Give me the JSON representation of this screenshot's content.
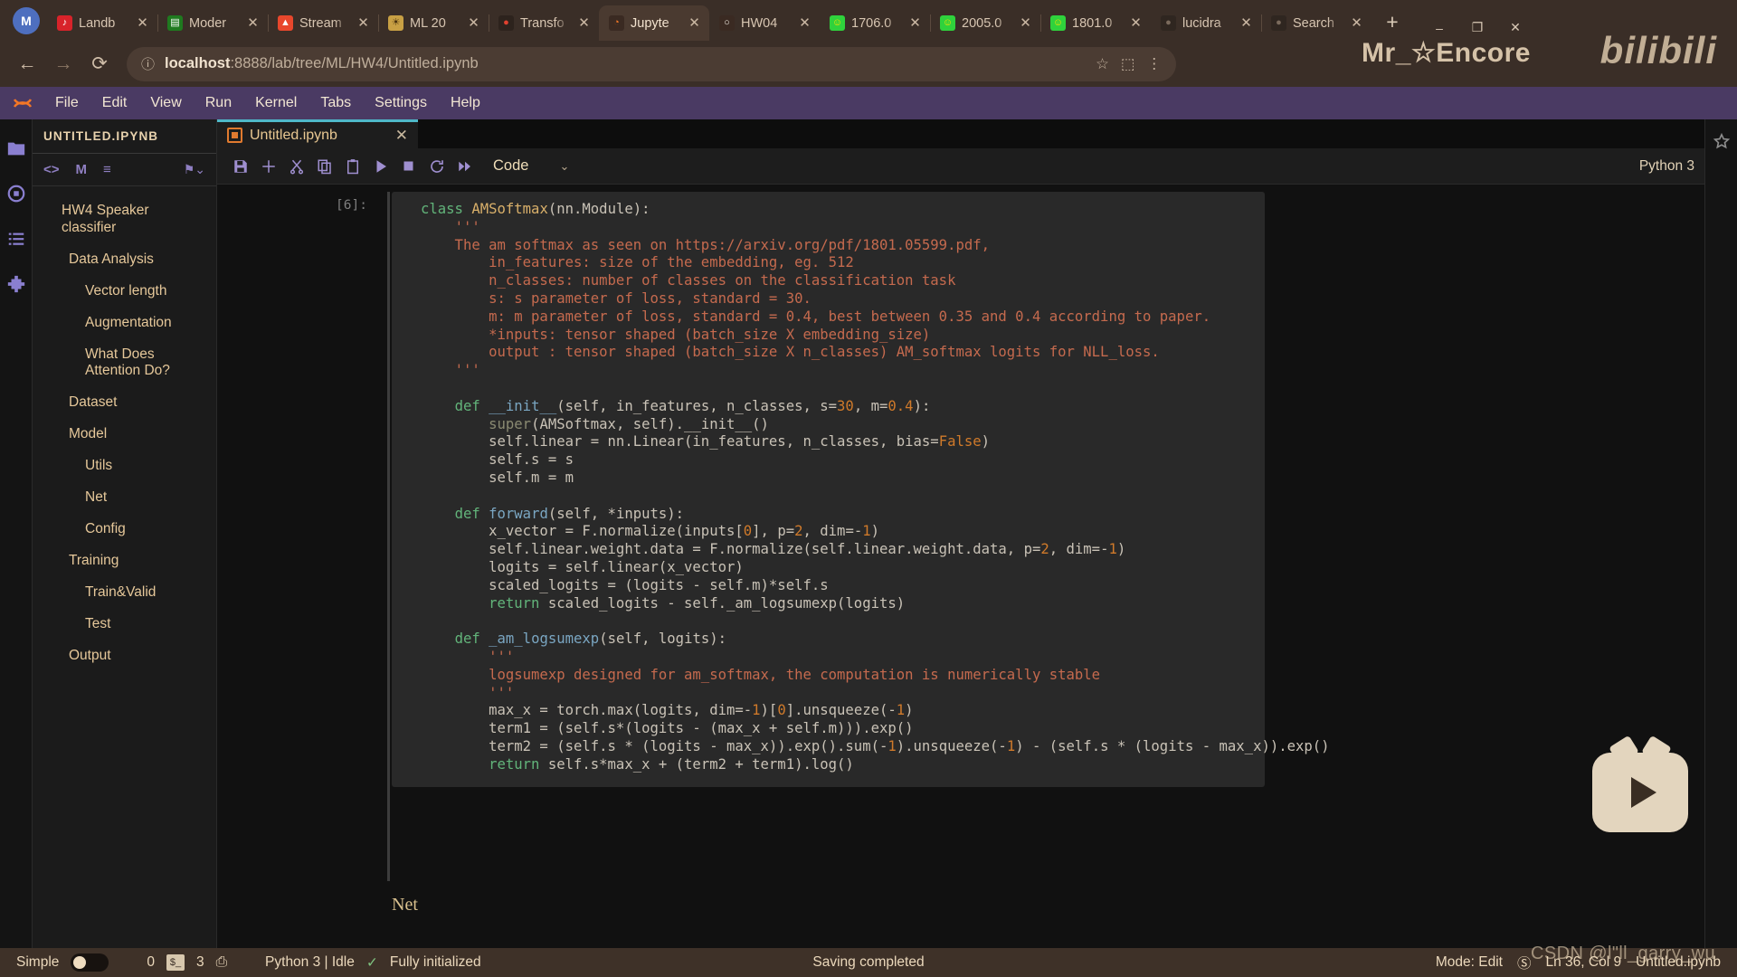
{
  "browser": {
    "profile_initial": "M",
    "tabs": [
      {
        "title": "Landb",
        "icon": "netease-music-icon",
        "glyph": "♪",
        "bg": "#d8232a",
        "fg": "#ffffff",
        "active": false
      },
      {
        "title": "Moder",
        "icon": "model-icon",
        "glyph": "▤",
        "bg": "#1f7a1f",
        "fg": "#ffffff",
        "active": false
      },
      {
        "title": "Stream",
        "icon": "streamlit-icon",
        "glyph": "▲",
        "bg": "#e8472c",
        "fg": "#ffffff",
        "active": false
      },
      {
        "title": "ML 20",
        "icon": "lion-icon",
        "glyph": "☀",
        "bg": "#c8a044",
        "fg": "#4a3310",
        "active": false
      },
      {
        "title": "Transfo",
        "icon": "huggingface-icon",
        "glyph": "●",
        "bg": "#2d231d",
        "fg": "#e0412f",
        "active": false
      },
      {
        "title": "Jupyte",
        "icon": "jupyter-icon",
        "glyph": "◔",
        "bg": "#3a2a22",
        "fg": "#f37726",
        "active": true
      },
      {
        "title": "HW04",
        "icon": "colab-icon",
        "glyph": "○",
        "bg": "#3a2a22",
        "fg": "#f5f0e6",
        "active": false
      },
      {
        "title": "1706.0",
        "icon": "pdf-smiley-icon",
        "glyph": "☺",
        "bg": "#2fd23c",
        "fg": "#f5e000",
        "active": false
      },
      {
        "title": "2005.0",
        "icon": "pdf-smiley-icon",
        "glyph": "☺",
        "bg": "#2fd23c",
        "fg": "#f5e000",
        "active": false
      },
      {
        "title": "1801.0",
        "icon": "pdf-smiley-icon",
        "glyph": "☺",
        "bg": "#2fd23c",
        "fg": "#f5e000",
        "active": false
      },
      {
        "title": "lucidra",
        "icon": "github-icon",
        "glyph": "●",
        "bg": "#2f2620",
        "fg": "#7a6a5c",
        "active": false
      },
      {
        "title": "Search",
        "icon": "github-icon",
        "glyph": "●",
        "bg": "#2f2620",
        "fg": "#7a6a5c",
        "active": false
      }
    ],
    "newtab_label": "+",
    "window_controls": [
      "–",
      "❐",
      "✕"
    ],
    "back_label": "←",
    "forward_label": "→",
    "reload_label": "⟳",
    "site_info_label": "ⓘ",
    "url_host": "localhost",
    "url_rest": ":8888/lab/tree/ML/HW4/Untitled.ipynb",
    "omnibox_actions": [
      "☆",
      "⬚",
      "⋮"
    ],
    "brand_watermark": "Mr_☆Encore",
    "bili_watermark": "bilibili"
  },
  "jupyter": {
    "menus": [
      "File",
      "Edit",
      "View",
      "Run",
      "Kernel",
      "Tabs",
      "Settings",
      "Help"
    ],
    "rail_icons": [
      "folder-icon",
      "running-icon",
      "commands-icon",
      "extensions-icon"
    ],
    "right_rail_icon": "property-inspector-icon",
    "toc": {
      "header": "UNTITLED.IPYNB",
      "tools": [
        "code-toggle-icon",
        "markdown-toggle-icon",
        "numbering-icon"
      ],
      "tag_icon": "tag-icon",
      "items": [
        {
          "label": "HW4 Speaker classifier",
          "level": 1
        },
        {
          "label": "Data Analysis",
          "level": 2
        },
        {
          "label": "Vector length",
          "level": 3
        },
        {
          "label": "Augmentation",
          "level": 3
        },
        {
          "label": "What Does Attention Do?",
          "level": 3
        },
        {
          "label": "Dataset",
          "level": 2
        },
        {
          "label": "Model",
          "level": 2
        },
        {
          "label": "Utils",
          "level": 3
        },
        {
          "label": "Net",
          "level": 3
        },
        {
          "label": "Config",
          "level": 3
        },
        {
          "label": "Training",
          "level": 2
        },
        {
          "label": "Train&Valid",
          "level": 3
        },
        {
          "label": "Test",
          "level": 3
        },
        {
          "label": "Output",
          "level": 2
        }
      ]
    },
    "notebook_tab": {
      "title": "Untitled.ipynb",
      "icon": "notebook-icon",
      "close_label": "✕"
    },
    "toolbar": {
      "buttons": [
        {
          "name": "save-button",
          "glyph": "Ὃe"
        },
        {
          "name": "insert-cell-button",
          "glyph": "+"
        },
        {
          "name": "cut-button",
          "glyph": "✂"
        },
        {
          "name": "copy-button",
          "glyph": "⧉"
        },
        {
          "name": "paste-button",
          "glyph": "Ὄb"
        },
        {
          "name": "run-button",
          "glyph": "▶"
        },
        {
          "name": "stop-button",
          "glyph": "■"
        },
        {
          "name": "restart-button",
          "glyph": "⟳"
        },
        {
          "name": "restart-run-all-button",
          "glyph": "⏩"
        }
      ],
      "cell_type": "Code",
      "cell_type_chevron": "⌄",
      "kernel_name": "Python 3"
    },
    "cell": {
      "prompt": "[6]:",
      "below_cell_text": "Net"
    }
  },
  "code_lines": [
    [
      [
        "k",
        "class "
      ],
      [
        "cls",
        "AMSoftmax"
      ],
      [
        "nm",
        "("
      ],
      [
        "nm",
        "nn.Module"
      ],
      [
        "nm",
        "):"
      ]
    ],
    [
      [
        "nm",
        "    "
      ],
      [
        "s",
        "'''"
      ]
    ],
    [
      [
        "s",
        "    The am softmax as seen on https://arxiv.org/pdf/1801.05599.pdf,"
      ]
    ],
    [
      [
        "s",
        "        in_features: size of the embedding, eg. 512"
      ]
    ],
    [
      [
        "s",
        "        n_classes: number of classes on the classification task"
      ]
    ],
    [
      [
        "s",
        "        s: s parameter of loss, standard = 30."
      ]
    ],
    [
      [
        "s",
        "        m: m parameter of loss, standard = 0.4, best between 0.35 and 0.4 according to paper."
      ]
    ],
    [
      [
        "s",
        "        *inputs: tensor shaped (batch_size X embedding_size)"
      ]
    ],
    [
      [
        "s",
        "        output : tensor shaped (batch_size X n_classes) AM_softmax logits for NLL_loss."
      ]
    ],
    [
      [
        "nm",
        "    "
      ],
      [
        "s",
        "'''"
      ]
    ],
    [
      [
        "nm",
        ""
      ]
    ],
    [
      [
        "nm",
        "    "
      ],
      [
        "k",
        "def "
      ],
      [
        "fn",
        "__init__"
      ],
      [
        "nm",
        "(self, in_features, n_classes, s="
      ],
      [
        "kw",
        "30"
      ],
      [
        "nm",
        ", m="
      ],
      [
        "kw",
        "0.4"
      ],
      [
        "nm",
        "):"
      ]
    ],
    [
      [
        "nm",
        "        "
      ],
      [
        "sup",
        "super"
      ],
      [
        "nm",
        "(AMSoftmax, self).__init__()"
      ]
    ],
    [
      [
        "nm",
        "        self.linear = nn.Linear(in_features, n_classes, bias="
      ],
      [
        "kw",
        "False"
      ],
      [
        "nm",
        ")"
      ]
    ],
    [
      [
        "nm",
        "        self.s = s"
      ]
    ],
    [
      [
        "nm",
        "        self.m = m"
      ]
    ],
    [
      [
        "nm",
        ""
      ]
    ],
    [
      [
        "nm",
        "    "
      ],
      [
        "k",
        "def "
      ],
      [
        "fn",
        "forward"
      ],
      [
        "nm",
        "(self, *inputs):"
      ]
    ],
    [
      [
        "nm",
        "        x_vector = F.normalize(inputs["
      ],
      [
        "kw",
        "0"
      ],
      [
        "nm",
        "], p="
      ],
      [
        "kw",
        "2"
      ],
      [
        "nm",
        ", dim=-"
      ],
      [
        "kw",
        "1"
      ],
      [
        "nm",
        ")"
      ]
    ],
    [
      [
        "nm",
        "        self.linear.weight.data = F.normalize(self.linear.weight.data, p="
      ],
      [
        "kw",
        "2"
      ],
      [
        "nm",
        ", dim=-"
      ],
      [
        "kw",
        "1"
      ],
      [
        "nm",
        ")"
      ]
    ],
    [
      [
        "nm",
        "        logits = self.linear(x_vector)"
      ]
    ],
    [
      [
        "nm",
        "        scaled_logits = (logits - self.m)*self.s"
      ]
    ],
    [
      [
        "nm",
        "        "
      ],
      [
        "k",
        "return "
      ],
      [
        "nm",
        "scaled_logits - self._am_logsumexp(logits)"
      ]
    ],
    [
      [
        "nm",
        ""
      ]
    ],
    [
      [
        "nm",
        "    "
      ],
      [
        "k",
        "def "
      ],
      [
        "fn",
        "_am_logsumexp"
      ],
      [
        "nm",
        "(self, logits):"
      ]
    ],
    [
      [
        "nm",
        "        "
      ],
      [
        "s",
        "'''"
      ]
    ],
    [
      [
        "s",
        "        logsumexp designed for am_softmax, the computation is numerically stable"
      ]
    ],
    [
      [
        "nm",
        "        "
      ],
      [
        "s",
        "'''"
      ]
    ],
    [
      [
        "nm",
        "        max_x = torch.max(logits, dim=-"
      ],
      [
        "kw",
        "1"
      ],
      [
        "nm",
        ")["
      ],
      [
        "kw",
        "0"
      ],
      [
        "nm",
        "].unsqueeze(-"
      ],
      [
        "kw",
        "1"
      ],
      [
        "nm",
        ")"
      ]
    ],
    [
      [
        "nm",
        "        term1 = (self.s*(logits - (max_x + self.m))).exp()"
      ]
    ],
    [
      [
        "nm",
        "        term2 = (self.s * (logits - max_x)).exp().sum(-"
      ],
      [
        "kw",
        "1"
      ],
      [
        "nm",
        ").unsqueeze(-"
      ],
      [
        "kw",
        "1"
      ],
      [
        "nm",
        ") - (self.s * (logits - max_x)).exp()"
      ]
    ],
    [
      [
        "nm",
        "        "
      ],
      [
        "k",
        "return "
      ],
      [
        "nm",
        "self.s*max_x + (term2 + term1).log()"
      ]
    ]
  ],
  "statusbar": {
    "simple_label": "Simple",
    "terminals_count": "0",
    "kernels_count": "3",
    "kernel_badge": "$_",
    "kernel_icon": "cpu-icon",
    "kernel_status": "Python 3 | Idle",
    "init_icon": "check-icon",
    "init_status": "Fully initialized",
    "save_status": "Saving completed",
    "mode": "Mode: Edit",
    "notifications_icon": "bell-off-icon",
    "cursor_position": "Ln 36, Col 9",
    "file_name": "Untitled.ipynb",
    "csdn_watermark": "CSDN @l\"ll_garry_wu"
  }
}
